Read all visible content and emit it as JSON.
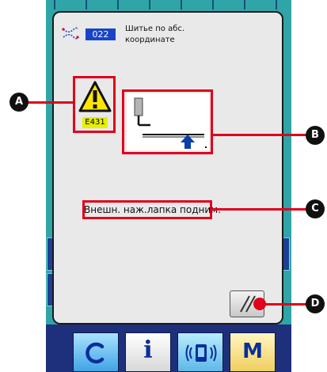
{
  "header": {
    "function_code": "022",
    "title": "Шитье по абс.\nкоординате",
    "icon": "coordinate-stitch-icon"
  },
  "error": {
    "code": "E431",
    "icon": "warning-triangle-icon",
    "diagram_icon": "presser-foot-up-icon",
    "message": "Внешн. наж.лапка подним."
  },
  "callouts": {
    "a": "A",
    "b": "B",
    "c": "C",
    "d": "D"
  },
  "bottom_bar": {
    "info_label": "i",
    "mode_label": "M",
    "items": [
      "thread-winding-icon",
      "info-icon",
      "communication-icon",
      "mode-icon"
    ]
  },
  "colors": {
    "screen": "#2fa5a8",
    "code_badge": "#1844c8",
    "error_code_bg": "#e6f000",
    "callout_line": "#e0001a",
    "bottom_bar": "#1e2f7c",
    "arrow": "#0a3fa8"
  }
}
